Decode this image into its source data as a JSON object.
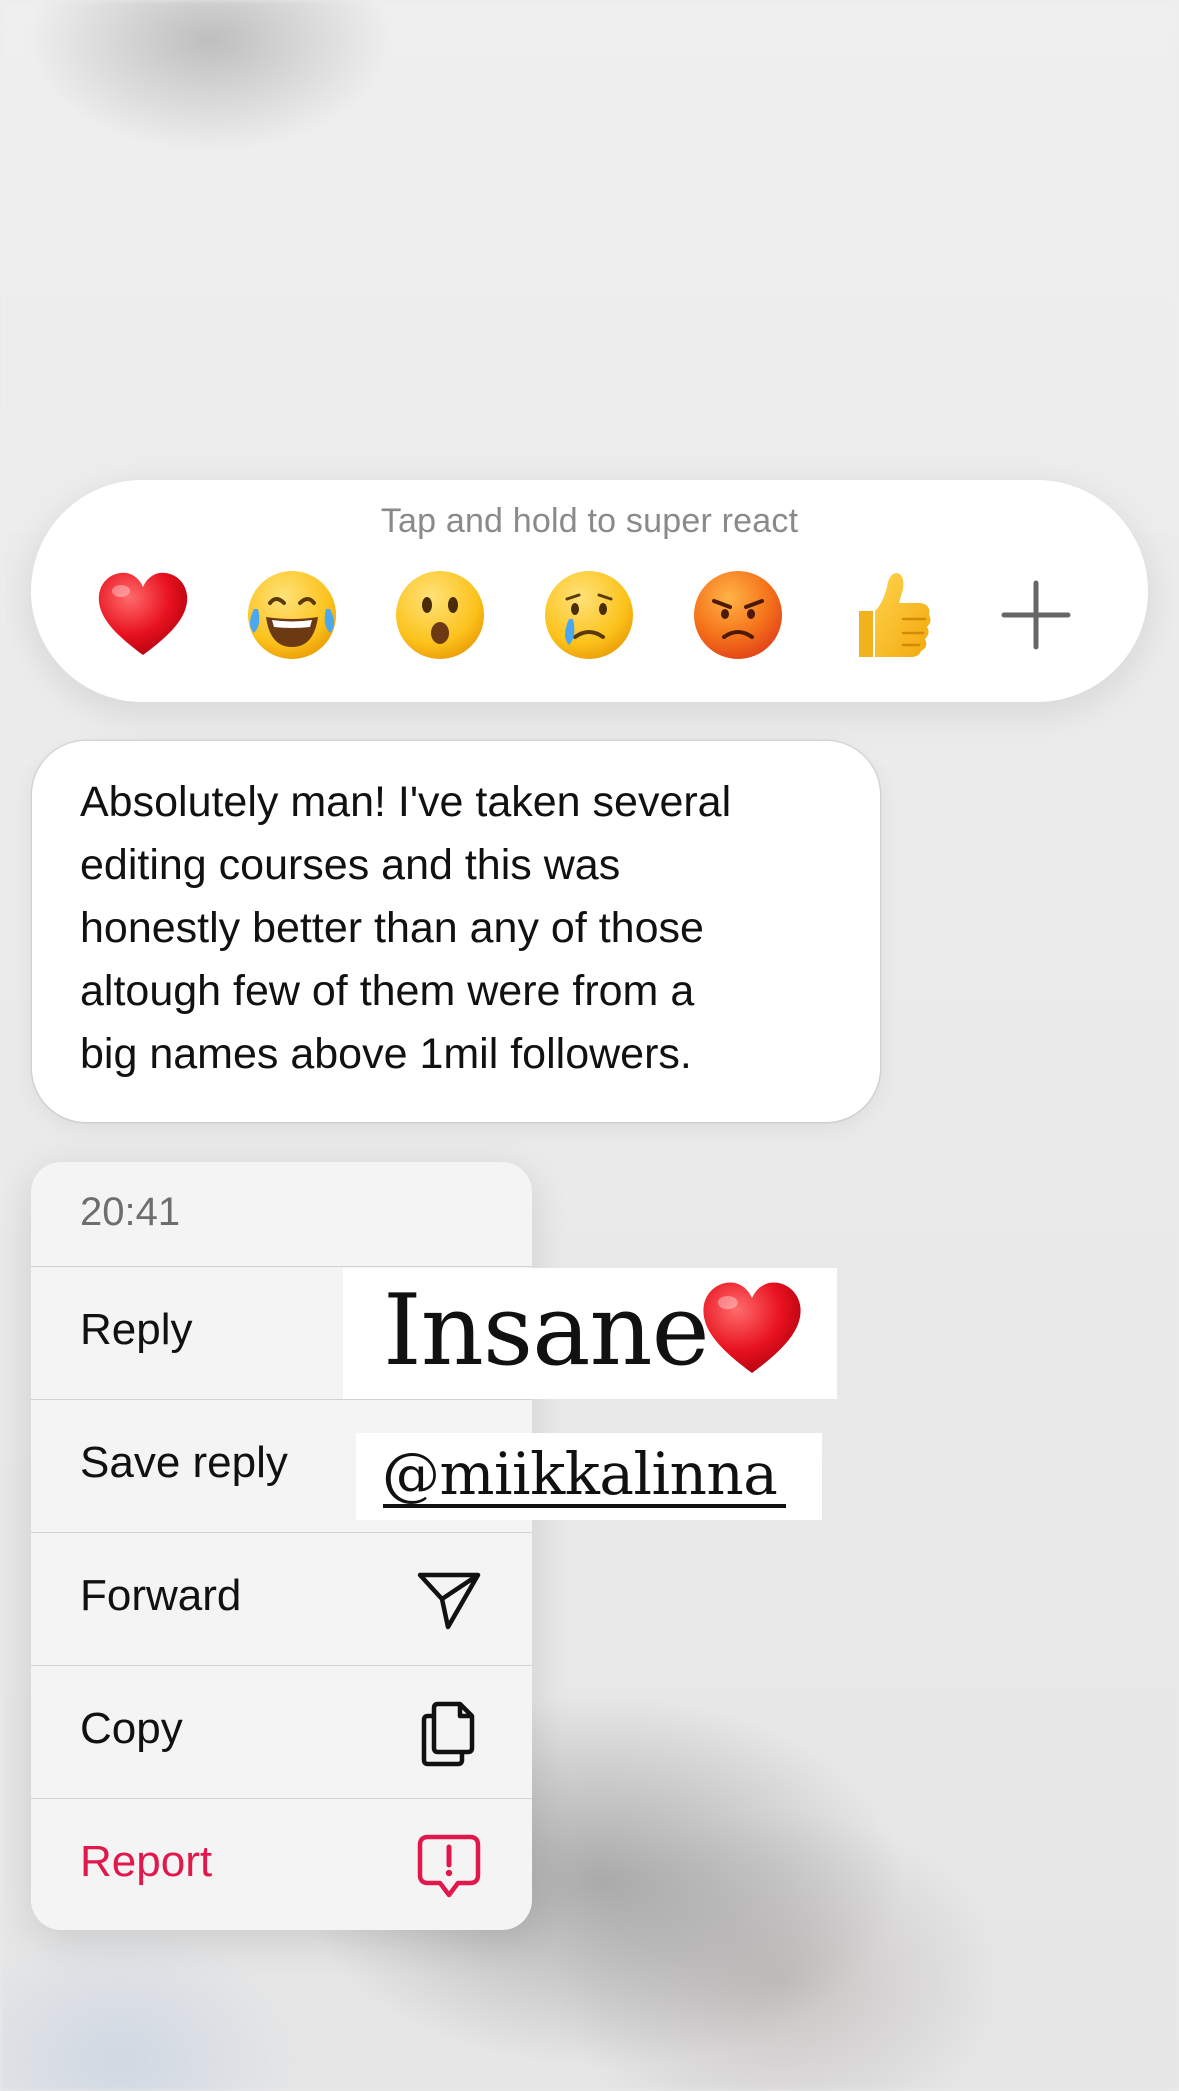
{
  "reaction_bar": {
    "hint": "Tap and hold to super react",
    "reactions": [
      {
        "name": "red-heart-emoji"
      },
      {
        "name": "tears-of-joy-emoji"
      },
      {
        "name": "surprised-face-emoji"
      },
      {
        "name": "crying-face-emoji"
      },
      {
        "name": "angry-face-emoji"
      },
      {
        "name": "thumbs-up-emoji"
      },
      {
        "name": "plus-icon"
      }
    ]
  },
  "message": {
    "lines": [
      "Absolutely man! I've taken several",
      "editing courses and this was",
      "honestly better than any of those",
      "altough few of them were from a",
      "big names above 1mil followers."
    ]
  },
  "menu": {
    "time": "20:41",
    "items": [
      {
        "label": "Reply",
        "icon": "reply-icon"
      },
      {
        "label": "Save reply",
        "icon": "bookmark-icon"
      },
      {
        "label": "Forward",
        "icon": "send-icon"
      },
      {
        "label": "Copy",
        "icon": "copy-icon"
      },
      {
        "label": "Report",
        "icon": "report-icon"
      }
    ]
  },
  "stickers": {
    "insane": "Insane",
    "mention": "@miikkalinna"
  },
  "colors": {
    "danger": "#e0184c",
    "menu_bg": "#f4f4f4",
    "hint_gray": "#8a8a8a"
  }
}
